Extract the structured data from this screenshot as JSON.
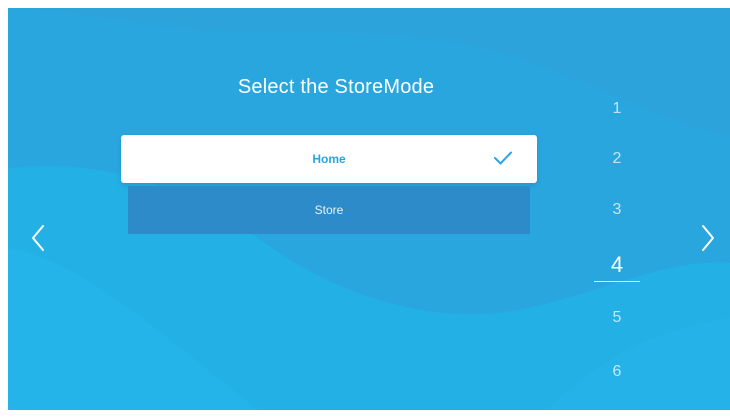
{
  "screen": {
    "title": "Select the StoreMode"
  },
  "options": [
    {
      "label": "Home",
      "selected": true,
      "indicator_icon": "check-icon"
    },
    {
      "label": "Store",
      "selected": false
    }
  ],
  "navigation": {
    "prev_icon": "chevron-left-icon",
    "next_icon": "chevron-right-icon"
  },
  "steps": {
    "items": [
      "1",
      "2",
      "3",
      "4",
      "5",
      "6"
    ],
    "current": "4"
  },
  "colors": {
    "background": "#2aa6df",
    "selected_option_bg": "#ffffff",
    "selected_option_text": "#2aa6df",
    "unselected_option_bg": "#2e8bc9",
    "text": "#ffffff"
  }
}
